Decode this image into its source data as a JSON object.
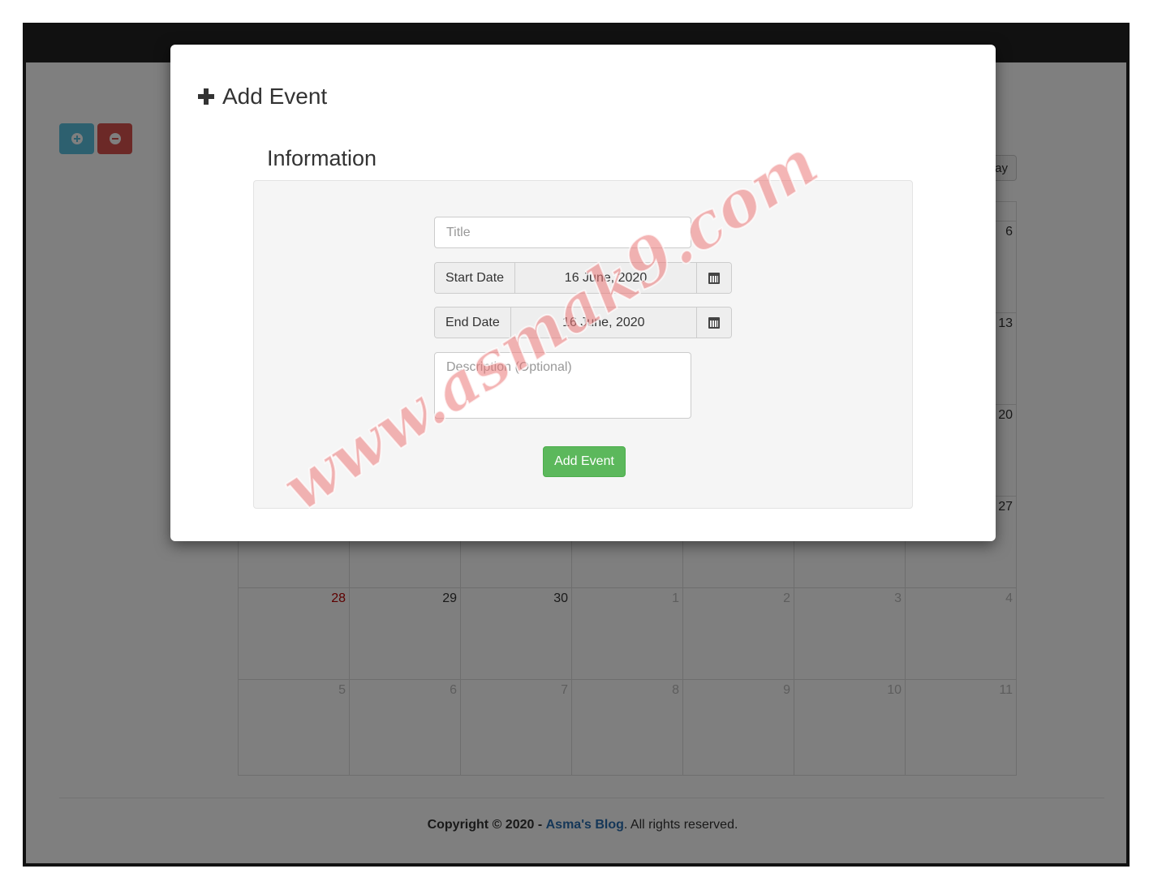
{
  "toolbar": {
    "add_icon": "plus-circle-icon",
    "remove_icon": "minus-circle-icon",
    "today_label": "ay"
  },
  "calendar": {
    "rows": [
      {
        "cells": [
          {
            "label": "",
            "type": "current"
          },
          {
            "label": "",
            "type": "current"
          },
          {
            "label": "",
            "type": "current"
          },
          {
            "label": "",
            "type": "current"
          },
          {
            "label": "",
            "type": "current"
          },
          {
            "label": "",
            "type": "current"
          },
          {
            "label": "6",
            "type": "current"
          }
        ]
      },
      {
        "cells": [
          {
            "label": "",
            "type": "current"
          },
          {
            "label": "",
            "type": "current"
          },
          {
            "label": "",
            "type": "current"
          },
          {
            "label": "",
            "type": "current"
          },
          {
            "label": "",
            "type": "current"
          },
          {
            "label": "",
            "type": "current"
          },
          {
            "label": "13",
            "type": "current"
          }
        ]
      },
      {
        "cells": [
          {
            "label": "",
            "type": "current"
          },
          {
            "label": "",
            "type": "current"
          },
          {
            "label": "",
            "type": "current"
          },
          {
            "label": "",
            "type": "current"
          },
          {
            "label": "",
            "type": "current"
          },
          {
            "label": "",
            "type": "current"
          },
          {
            "label": "20",
            "type": "current"
          }
        ]
      },
      {
        "cells": [
          {
            "label": "",
            "type": "current"
          },
          {
            "label": "",
            "type": "current"
          },
          {
            "label": "",
            "type": "current"
          },
          {
            "label": "",
            "type": "current"
          },
          {
            "label": "",
            "type": "current"
          },
          {
            "label": "",
            "type": "current"
          },
          {
            "label": "27",
            "type": "current"
          }
        ]
      },
      {
        "cells": [
          {
            "label": "28",
            "type": "sunday"
          },
          {
            "label": "29",
            "type": "current"
          },
          {
            "label": "30",
            "type": "current"
          },
          {
            "label": "1",
            "type": "other"
          },
          {
            "label": "2",
            "type": "other"
          },
          {
            "label": "3",
            "type": "other"
          },
          {
            "label": "4",
            "type": "other"
          }
        ]
      },
      {
        "cells": [
          {
            "label": "5",
            "type": "other"
          },
          {
            "label": "6",
            "type": "other"
          },
          {
            "label": "7",
            "type": "other"
          },
          {
            "label": "8",
            "type": "other"
          },
          {
            "label": "9",
            "type": "other"
          },
          {
            "label": "10",
            "type": "other"
          },
          {
            "label": "11",
            "type": "other"
          }
        ]
      }
    ]
  },
  "footer": {
    "copyright": "Copyright © 2020 -",
    "brand": "Asma's Blog",
    "rights": ". All rights reserved."
  },
  "modal": {
    "title": "Add Event",
    "title_icon": "plus-icon",
    "section_title": "Information",
    "title_placeholder": "Title",
    "start_label": "Start Date",
    "start_value": "16 June, 2020",
    "end_label": "End Date",
    "end_value": "16 June, 2020",
    "calendar_icon": "calendar-icon",
    "description_placeholder": "Description (Optional)",
    "submit_label": "Add Event"
  },
  "watermark": "www.asmak9.com",
  "colors": {
    "info": "#5bc0de",
    "danger": "#d9534f",
    "success": "#5cb85c",
    "link": "#2a6eb0",
    "topbar": "#222222"
  }
}
